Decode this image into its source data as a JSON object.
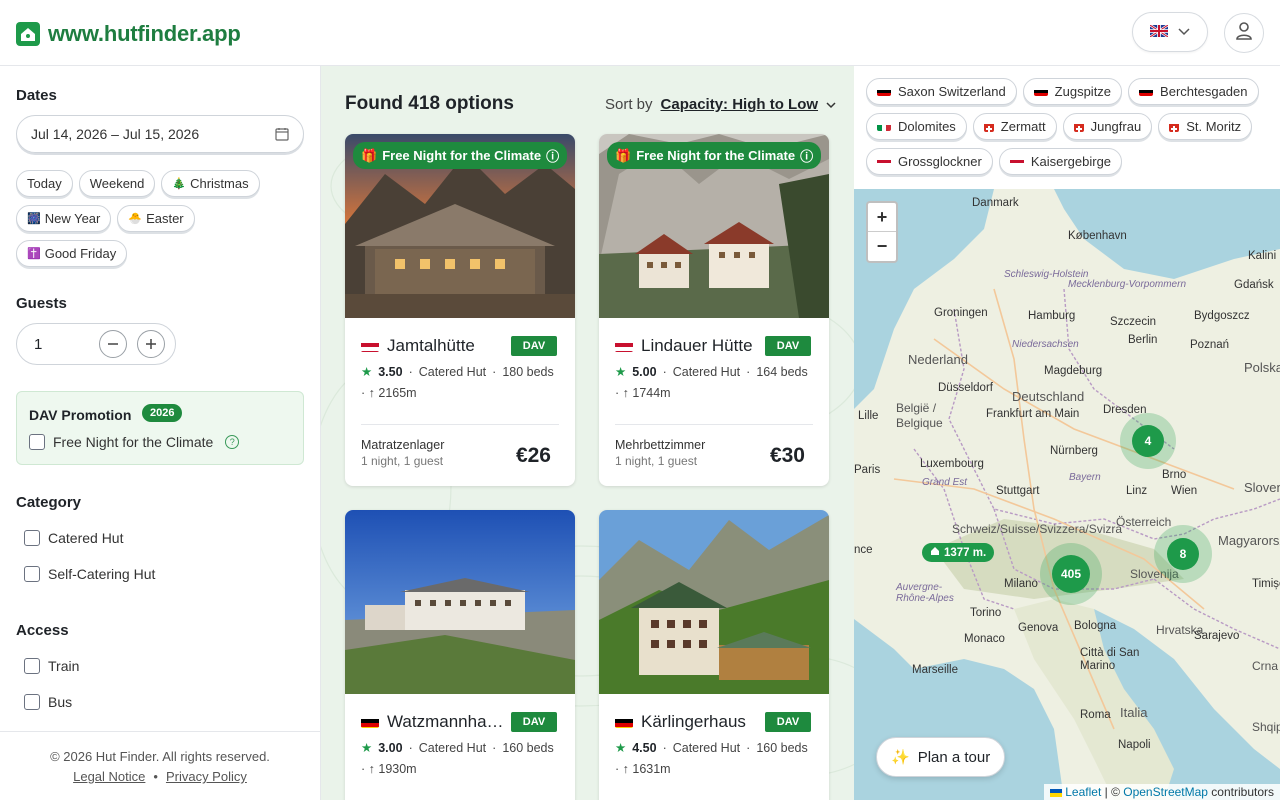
{
  "header": {
    "site_name": "www.hutfinder.app",
    "language_flag": "🇬🇧"
  },
  "sidebar": {
    "dates_title": "Dates",
    "date_value": "Jul 14, 2026 – Jul 15, 2026",
    "date_chips": [
      {
        "label": "Today",
        "emoji": ""
      },
      {
        "label": "Weekend",
        "emoji": ""
      },
      {
        "label": "Christmas",
        "emoji": "🎄"
      },
      {
        "label": "New Year",
        "emoji": "🎆"
      },
      {
        "label": "Easter",
        "emoji": "🐣"
      },
      {
        "label": "Good Friday",
        "emoji": "✝️"
      }
    ],
    "guests_title": "Guests",
    "guests_value": "1",
    "promo": {
      "title": "DAV Promotion",
      "badge": "2026",
      "checkbox_label": "Free Night for the Climate",
      "help": "?"
    },
    "category_title": "Category",
    "categories": [
      "Catered Hut",
      "Self-Catering Hut"
    ],
    "access_title": "Access",
    "access": [
      "Train",
      "Bus"
    ],
    "footer": {
      "copyright": "© 2026 Hut Finder. All rights reserved.",
      "legal": "Legal Notice",
      "sep": "•",
      "privacy": "Privacy Policy"
    }
  },
  "results": {
    "found": "Found 418 options",
    "sort_label": "Sort by",
    "sort_value": "Capacity: High to Low",
    "promo_badge": "Free Night for the Climate",
    "dav_label": "DAV",
    "cards": [
      {
        "name": "Jamtalhütte",
        "country": "AT",
        "rating": "3.50",
        "category": "Catered Hut",
        "beds": "180 beds",
        "altitude": "2165m",
        "room": "Matratzenlager",
        "room_sub": "1 night, 1 guest",
        "price": "€26",
        "promo": true
      },
      {
        "name": "Lindauer Hütte",
        "country": "AT",
        "rating": "5.00",
        "category": "Catered Hut",
        "beds": "164 beds",
        "altitude": "1744m",
        "room": "Mehrbettzimmer",
        "room_sub": "1 night, 1 guest",
        "price": "€30",
        "promo": true
      },
      {
        "name": "Watzmannha…",
        "country": "DE",
        "rating": "3.00",
        "category": "Catered Hut",
        "beds": "160 beds",
        "altitude": "1930m",
        "room": "",
        "room_sub": "",
        "price": "",
        "promo": false
      },
      {
        "name": "Kärlingerhaus",
        "country": "DE",
        "rating": "4.50",
        "category": "Catered Hut",
        "beds": "160 beds",
        "altitude": "1631m",
        "room": "",
        "room_sub": "",
        "price": "",
        "promo": false
      }
    ]
  },
  "map": {
    "regions": [
      {
        "label": "Saxon Switzerland",
        "country": "DE"
      },
      {
        "label": "Zugspitze",
        "country": "DE"
      },
      {
        "label": "Berchtesgaden",
        "country": "DE"
      },
      {
        "label": "Dolomites",
        "country": "IT"
      },
      {
        "label": "Zermatt",
        "country": "CH"
      },
      {
        "label": "Jungfrau",
        "country": "CH"
      },
      {
        "label": "St. Moritz",
        "country": "CH"
      },
      {
        "label": "Grossglockner",
        "country": "AT"
      },
      {
        "label": "Kaisergebirge",
        "country": "AT"
      }
    ],
    "zoom_in": "+",
    "zoom_out": "−",
    "clusters": [
      "4",
      "8",
      "405"
    ],
    "hut_pin": "1377 m.",
    "plan_tour": "Plan a tour",
    "attribution": {
      "leaflet": "Leaflet",
      "sep": " | © ",
      "osm": "OpenStreetMap",
      "suffix": " contributors"
    },
    "labels": [
      "Danmark",
      "København",
      "Kalini",
      "Schleswig-Holstein",
      "Mecklenburg-Vorpommern",
      "Gdańsk",
      "Hamburg",
      "Szczecin",
      "Bydgoszcz",
      "Groningen",
      "Nederland",
      "Niedersachsen",
      "Berlin",
      "Poznań",
      "Magdeburg",
      "Polska",
      "Düsseldorf",
      "Deutschland",
      "Lille",
      "België / Belgique",
      "Frankfurt am Main",
      "Dresden",
      "Nürnberg",
      "Luxembourg",
      "Paris",
      "Grand Est",
      "Bayern",
      "Stuttgart",
      "Linz",
      "Brno",
      "Wien",
      "Slovensk",
      "Österreich",
      "Schweiz/Suisse/Svizzera/Svizra",
      "Magyarorsz",
      "Milano",
      "Slovenija",
      "Timișoa",
      "Auvergne-Rhône-Alpes",
      "Torino",
      "Genova",
      "Bologna",
      "Hrvatska",
      "Monaco",
      "Marseille",
      "Città di San Marino",
      "Sarajevo",
      "Crna Gora",
      "Roma",
      "Italia",
      "Shqipër",
      "Napoli",
      "nce"
    ]
  }
}
